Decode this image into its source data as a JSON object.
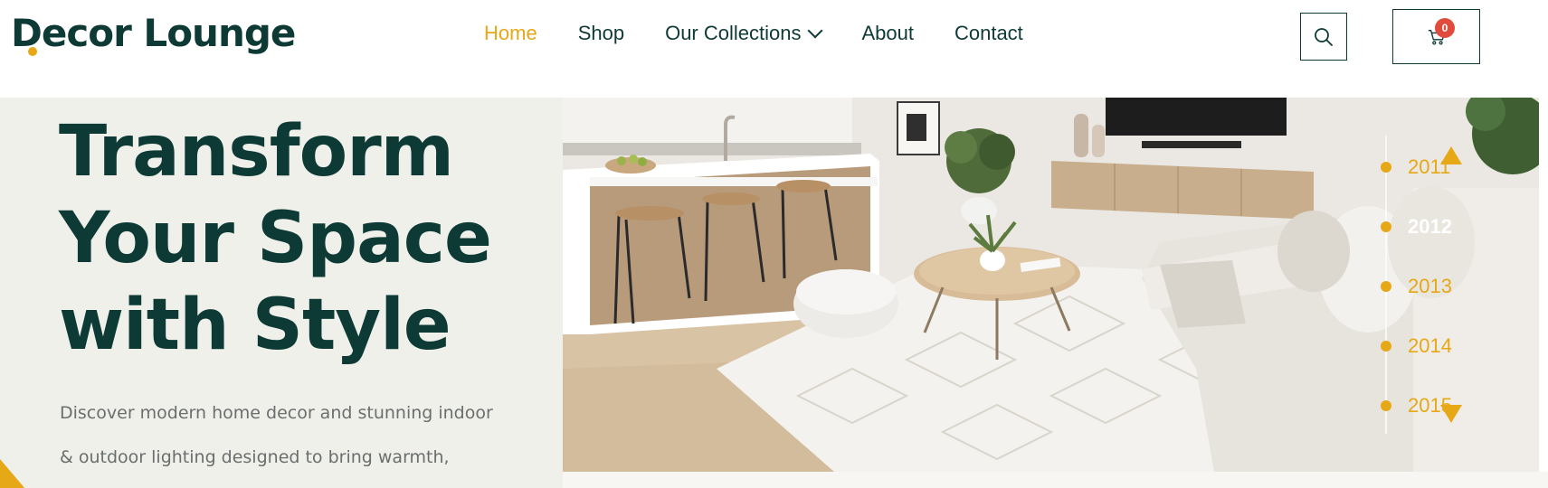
{
  "header": {
    "logo_text": "Decor Lounge",
    "nav": [
      {
        "label": "Home",
        "active": true
      },
      {
        "label": "Shop"
      },
      {
        "label": "Our Collections",
        "has_dropdown": true
      },
      {
        "label": "About"
      },
      {
        "label": "Contact"
      }
    ],
    "search_icon": "search-icon",
    "cart_icon": "cart-icon",
    "cart_count": "0"
  },
  "hero": {
    "title_lines": [
      "Transform",
      "Your Space",
      "with Style"
    ],
    "subtitle_lines": [
      "Discover modern home decor and stunning indoor",
      "& outdoor lighting designed to bring warmth,"
    ],
    "image_alt": "living-room-photo"
  },
  "timeline": {
    "years": [
      "2011",
      "2012",
      "2013",
      "2014",
      "2015"
    ],
    "active_year": "2012"
  },
  "colors": {
    "brand_dark": "#0e3a35",
    "accent": "#e6a817",
    "badge": "#e04b3d",
    "hero_bg": "#f0f0eb"
  }
}
